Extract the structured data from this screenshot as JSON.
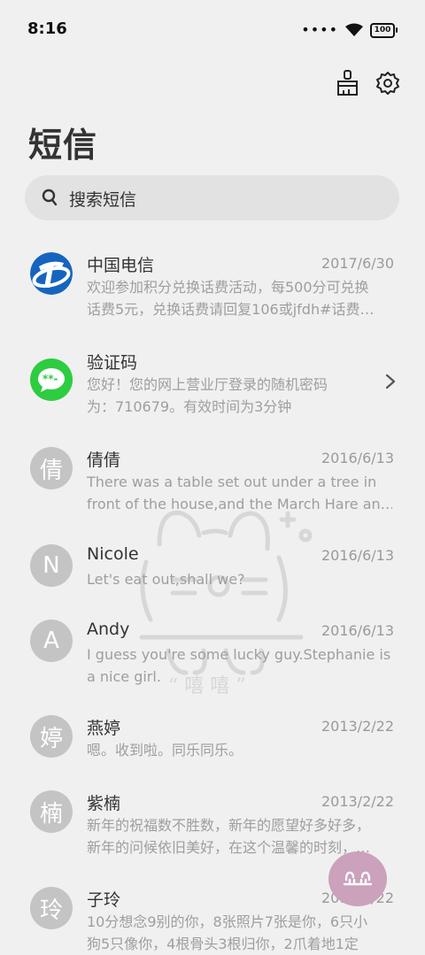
{
  "status": {
    "time": "8:16",
    "battery": "100"
  },
  "title": "短信",
  "search": {
    "placeholder": "搜索短信"
  },
  "conversations": [
    {
      "name": "中国电信",
      "date": "2017/6/30",
      "line1": "欢迎参加积分兑换话费活动，每500分可兑换",
      "line2": "话费5元，兑换话费请回复106或jfdh#话费…"
    },
    {
      "name": "验证码",
      "date": "",
      "line1": "您好！您的网上营业厅登录的随机密码",
      "line2": "为：710679。有效时间为3分钟"
    },
    {
      "avatar": "倩",
      "name": "倩倩",
      "date": "2016/6/13",
      "line1": "There was a table set out under a tree in",
      "line2": "front of the house,and the March Hare an…"
    },
    {
      "avatar": "N",
      "name": "Nicole",
      "date": "2016/6/13",
      "line1": "Let's eat out,shall we?",
      "line2": ""
    },
    {
      "avatar": "A",
      "name": "Andy",
      "date": "2016/6/13",
      "line1": "I guess you're some lucky guy.Stephanie is",
      "line2": "a nice girl."
    },
    {
      "avatar": "婷",
      "name": "燕婷",
      "date": "2013/2/22",
      "line1": "嗯。收到啦。同乐同乐。",
      "line2": ""
    },
    {
      "avatar": "楠",
      "name": "紫楠",
      "date": "2013/2/22",
      "line1": "新年的祝福数不胜数，新年的愿望好多好多，",
      "line2": "新年的问候依旧美好，在这个温馨的时刻，…"
    },
    {
      "avatar": "玲",
      "name": "子玲",
      "date": "2013/2/22",
      "line1": "10分想念9别的你，8张照片7张是你，6只小",
      "line2": "狗5只像你，4根骨头3根归你，2爪着地1定"
    }
  ],
  "watermark_text": "“ 嘻 嘻 ”",
  "colors": {
    "telecom_blue": "#1565c0",
    "verify_green": "#2ecc40",
    "fab_pink": "#cba1bc"
  }
}
